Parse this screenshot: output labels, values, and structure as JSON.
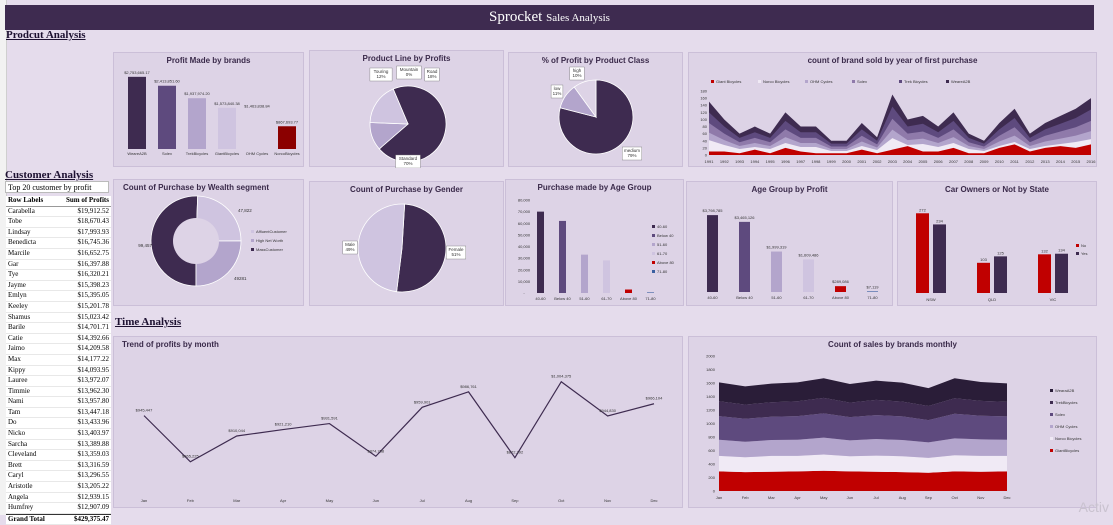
{
  "dashboard": {
    "title_main": "Sprocket",
    "title_sub": "Sales Analysis"
  },
  "sections": {
    "product": "Prodcut Analysis",
    "customer": "Customer Analysis",
    "time": "Time Analysis"
  },
  "table": {
    "caption": "Top 20 customer by profit",
    "headers": [
      "Row Labels",
      "Sum of Profits"
    ],
    "rows": [
      [
        "Carabella",
        "$19,912.52"
      ],
      [
        "Tobe",
        "$18,670.43"
      ],
      [
        "Lindsay",
        "$17,993.93"
      ],
      [
        "Benedicta",
        "$16,745.36"
      ],
      [
        "Marcile",
        "$16,652.75"
      ],
      [
        "Gar",
        "$16,397.88"
      ],
      [
        "Tye",
        "$16,320.21"
      ],
      [
        "Jayme",
        "$15,398.23"
      ],
      [
        "Emlyn",
        "$15,395.05"
      ],
      [
        "Keeley",
        "$15,201.78"
      ],
      [
        "Shamus",
        "$15,023.42"
      ],
      [
        "Barile",
        "$14,701.71"
      ],
      [
        "Catie",
        "$14,392.66"
      ],
      [
        "Jaimo",
        "$14,209.58"
      ],
      [
        "Max",
        "$14,177.22"
      ],
      [
        "Kippy",
        "$14,093.95"
      ],
      [
        "Lauree",
        "$13,972.07"
      ],
      [
        "Timmie",
        "$13,962.30"
      ],
      [
        "Nami",
        "$13,957.80"
      ],
      [
        "Tam",
        "$13,447.18"
      ],
      [
        "Do",
        "$13,433.96"
      ],
      [
        "Nicko",
        "$13,403.97"
      ],
      [
        "Sarcha",
        "$13,389.88"
      ],
      [
        "Cleveland",
        "$13,359.03"
      ],
      [
        "Brett",
        "$13,316.59"
      ],
      [
        "Caryl",
        "$13,296.55"
      ],
      [
        "Aristotle",
        "$13,205.22"
      ],
      [
        "Angela",
        "$12,939.15"
      ],
      [
        "Humfrey",
        "$12,907.09"
      ]
    ],
    "total_label": "Grand Total",
    "total_value": "$429,375.47"
  },
  "watermark": "Activ",
  "colors": {
    "dark": "#3e2b50",
    "mid": "#5e4a7e",
    "light": "#b3a5cc",
    "pale": "#cfc4e0",
    "red": "#c00000"
  },
  "chart_data": [
    {
      "id": "profit_by_brand",
      "type": "bar",
      "title": "Profit Made by brands",
      "categories": [
        "WeareA2B",
        "Solex",
        "TrekBicycles",
        "GiantBicycles",
        "OHM Cycles",
        "NorcoBicycles"
      ],
      "values": [
        2753665.17,
        2413851.6,
        1937974.2,
        1573840.38,
        1463838.84,
        867693.77
      ],
      "labels": [
        "$2,753,665.17",
        "$2,413,851.60",
        "$1,937,974.20",
        "$1,573,840.38",
        "$1,463,838.84",
        "$867,693.77"
      ],
      "colors": [
        "#3e2b50",
        "#5e4a7e",
        "#b3a5cc",
        "#cfc4e0",
        "#ddd3e6",
        "#8b0000"
      ]
    },
    {
      "id": "product_line_profit",
      "type": "pie",
      "title": "Product Line by Profits",
      "slices": [
        {
          "name": "Standard",
          "value": 70,
          "label": "Standard\n70%",
          "color": "#3e2b50"
        },
        {
          "name": "Touring",
          "value": 12,
          "label": "Touring\n12%",
          "color": "#b3a5cc"
        },
        {
          "name": "Mountain",
          "value": 0,
          "label": "Mountain\n0%",
          "color": "#8f7aaa"
        },
        {
          "name": "Road",
          "value": 18,
          "label": "Road\n18%",
          "color": "#cfc4e0"
        }
      ]
    },
    {
      "id": "profit_by_class",
      "type": "pie",
      "title": "% of Profit by Product Class",
      "slices": [
        {
          "name": "medium",
          "value": 79,
          "label": "medium\n79%",
          "color": "#3e2b50"
        },
        {
          "name": "low",
          "value": 11,
          "label": "low\n11%",
          "color": "#b3a5cc"
        },
        {
          "name": "high",
          "value": 10,
          "label": "high\n10%",
          "color": "#ddd3e6"
        }
      ]
    },
    {
      "id": "brand_by_year",
      "type": "area",
      "title": "count of  brand sold by year of first purchase",
      "x": [
        "1991",
        "1992",
        "1993",
        "1994",
        "1995",
        "1996",
        "1997",
        "1998",
        "1999",
        "2000",
        "2001",
        "2002",
        "2003",
        "2004",
        "2005",
        "2006",
        "2007",
        "2008",
        "2009",
        "2010",
        "2011",
        "2012",
        "2013",
        "2014",
        "2015",
        "2016"
      ],
      "series_legend": [
        "Giant Bicycles",
        "Norco Bicycles",
        "OHM Cycles",
        "Solex",
        "Trek Bicycles",
        "WeareA2B"
      ],
      "y_ticks": [
        "0",
        "20",
        "40",
        "60",
        "80",
        "100",
        "120",
        "140",
        "160",
        "180"
      ],
      "total": [
        150,
        100,
        60,
        80,
        60,
        120,
        80,
        80,
        40,
        40,
        90,
        50,
        170,
        100,
        110,
        80,
        120,
        60,
        40,
        90,
        130,
        60,
        90,
        110,
        130,
        160
      ],
      "red": [
        10,
        10,
        5,
        15,
        5,
        20,
        10,
        5,
        5,
        5,
        15,
        5,
        15,
        25,
        10,
        10,
        20,
        5,
        5,
        20,
        30,
        10,
        20,
        25,
        20,
        30
      ]
    },
    {
      "id": "wealth_segment",
      "type": "pie",
      "title": "Count of Purchase by Wealth segment",
      "slices": [
        {
          "name": "Mass Customer",
          "value": 99457,
          "label": "99,457",
          "color": "#3e2b50"
        },
        {
          "name": "Affluent Customer",
          "value": 47822,
          "label": "47,822",
          "color": "#cfc4e0"
        },
        {
          "name": "High Net Worth",
          "value": 49281,
          "label": "49281",
          "color": "#b3a5cc"
        }
      ],
      "legend": [
        "AffluentCustomer",
        "High Net Worth",
        "MassCustomer"
      ]
    },
    {
      "id": "gender",
      "type": "pie",
      "title": "Count of Purchase by Gender",
      "slices": [
        {
          "name": "Female",
          "value": 51,
          "label": "Female\n51%",
          "color": "#3e2b50"
        },
        {
          "name": "Male",
          "value": 49,
          "label": "Male\n49%",
          "color": "#cfc4e0"
        }
      ]
    },
    {
      "id": "age_group_purchase",
      "type": "bar",
      "title": "Purchase made  by Age Group",
      "categories": [
        "40-60",
        "Below 40",
        "51-60",
        "61-70",
        "Above 80",
        "71-80"
      ],
      "values": [
        70000,
        62000,
        33000,
        28000,
        3000,
        500
      ],
      "y_ticks": [
        "-",
        "10,000",
        "20,000",
        "30,000",
        "40,000",
        "50,000",
        "60,000",
        "70,000",
        "80,000"
      ],
      "colors": [
        "#3e2b50",
        "#5e4a7e",
        "#b3a5cc",
        "#cfc4e0",
        "#c00000",
        "#3a5fa0"
      ],
      "legend": [
        "40-60",
        "Below 40",
        "51-60",
        "61-70",
        "Above 80",
        "71-80"
      ]
    },
    {
      "id": "age_group_profit",
      "type": "bar",
      "title": "Age Group by Profit",
      "categories": [
        "40-60",
        "Below 40",
        "51-60",
        "61-70",
        "Above 80",
        "71-80"
      ],
      "values": [
        3798785,
        3465126,
        1999319,
        1609486,
        289086,
        7119
      ],
      "labels": [
        "$3,798,785",
        "$3,465,126",
        "$1,999,319",
        "$1,609,486",
        "$289,086",
        "$7,119"
      ],
      "colors": [
        "#3e2b50",
        "#5e4a7e",
        "#b3a5cc",
        "#cfc4e0",
        "#c00000",
        "#3a5fa0"
      ]
    },
    {
      "id": "car_owners",
      "type": "bar",
      "title": "Car  Owners or Not by State",
      "categories": [
        "NSW",
        "QLD",
        "VIC"
      ],
      "series": [
        {
          "name": "No",
          "values": [
            272,
            103,
            132
          ],
          "color": "#c00000"
        },
        {
          "name": "Yes",
          "values": [
            234,
            125,
            134
          ],
          "color": "#3e2b50"
        }
      ]
    },
    {
      "id": "profit_trend",
      "type": "line",
      "title": "Trend of profits by month",
      "categories": [
        "Jan",
        "Feb",
        "Mar",
        "Apr",
        "May",
        "Jun",
        "Jul",
        "Aug",
        "Sep",
        "Oct",
        "Nov",
        "Dec"
      ],
      "values": [
        945447,
        865225,
        910044,
        921210,
        931591,
        874758,
        959901,
        986761,
        872292,
        1004375,
        944830,
        966104
      ],
      "labels": [
        "$945,447",
        "$865,225",
        "$910,044",
        "$921,210",
        "$931,591",
        "$874,758",
        "$959,901",
        "$986,761",
        "$872,292",
        "$1,004,375",
        "$944,830",
        "$966,104"
      ]
    },
    {
      "id": "brands_monthly",
      "type": "area",
      "title": "Count of sales by brands monthly",
      "categories": [
        "Jan",
        "Feb",
        "Mar",
        "Apr",
        "May",
        "Jun",
        "Jul",
        "Aug",
        "Sep",
        "Oct",
        "Nov",
        "Dec"
      ],
      "y_ticks": [
        "0",
        "200",
        "400",
        "600",
        "800",
        "1000",
        "1200",
        "1400",
        "1600",
        "1800",
        "2000"
      ],
      "series": [
        {
          "name": "GiantBicycles",
          "values": [
            290,
            280,
            285,
            290,
            300,
            290,
            285,
            280,
            270,
            290,
            285,
            290
          ],
          "color": "#c00000"
        },
        {
          "name": "Norco Bicycles",
          "values": [
            230,
            220,
            235,
            230,
            240,
            225,
            240,
            235,
            220,
            240,
            235,
            230
          ],
          "color": "#f0eaf5"
        },
        {
          "name": "OHM Cycles",
          "values": [
            240,
            230,
            235,
            240,
            250,
            235,
            245,
            240,
            230,
            250,
            245,
            240
          ],
          "color": "#b3a5cc"
        },
        {
          "name": "Solex",
          "values": [
            350,
            340,
            345,
            350,
            360,
            345,
            355,
            350,
            330,
            365,
            350,
            345
          ],
          "color": "#5e4a7e"
        },
        {
          "name": "TrekBicycles",
          "values": [
            220,
            210,
            215,
            220,
            230,
            215,
            225,
            220,
            210,
            230,
            220,
            215
          ],
          "color": "#3e2b50"
        },
        {
          "name": "WearaA2B",
          "values": [
            280,
            270,
            275,
            280,
            290,
            275,
            285,
            280,
            265,
            295,
            280,
            275
          ],
          "color": "#2a1d38"
        }
      ],
      "legend": [
        "WearaA2B",
        "TrekBicycles",
        "Solex",
        "OHM Cycles",
        "Norco Bicycles",
        "GiantBicycles"
      ]
    }
  ]
}
